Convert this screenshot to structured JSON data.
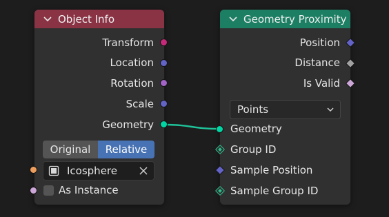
{
  "object_info": {
    "title": "Object Info",
    "outputs": {
      "transform": "Transform",
      "location": "Location",
      "rotation": "Rotation",
      "scale": "Scale",
      "geometry": "Geometry"
    },
    "transform_space": {
      "options": [
        "Original",
        "Relative"
      ],
      "selected": "Relative"
    },
    "object": {
      "value": "Icosphere"
    },
    "as_instance": {
      "label": "As Instance",
      "checked": false
    }
  },
  "geometry_proximity": {
    "title": "Geometry Proximity",
    "outputs": {
      "position": "Position",
      "distance": "Distance",
      "is_valid": "Is Valid"
    },
    "target_element": {
      "selected": "Points"
    },
    "inputs": {
      "geometry": "Geometry",
      "group_id": "Group ID",
      "sample_position": "Sample Position",
      "sample_group_id": "Sample Group ID"
    }
  },
  "colors": {
    "object_info_header": "#8a3345",
    "geometry_proximity_header": "#1c7f63",
    "geometry_socket": "#00d6a3",
    "vector_socket": "#6363c7",
    "matrix_socket": "#c7297a",
    "rotation_socket": "#a363c7",
    "float_socket": "#a1a1a1",
    "bool_socket": "#cca6d6",
    "int_socket": "#2bbf8e",
    "object_socket": "#ed9e5c",
    "link": "#1fc39a"
  }
}
